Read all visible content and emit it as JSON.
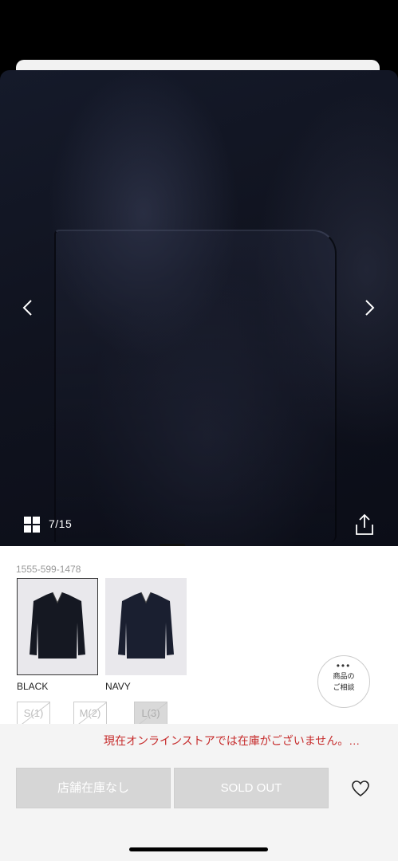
{
  "gallery": {
    "counter": "7/15",
    "prev_icon": "chevron-left-icon",
    "next_icon": "chevron-right-icon",
    "grid_icon": "grid-icon",
    "share_icon": "share-icon"
  },
  "product": {
    "code": "1555-599-1478",
    "colors": [
      {
        "label": "BLACK",
        "selected": true
      },
      {
        "label": "NAVY",
        "selected": false
      }
    ],
    "sizes": [
      {
        "label": "S(1)",
        "available": false
      },
      {
        "label": "M(2)",
        "available": false
      },
      {
        "label": "L(3)",
        "available": false
      }
    ],
    "consult": {
      "dots": "•••",
      "line1": "商品の",
      "line2": "ご相談"
    }
  },
  "stock": {
    "notice": "現在オンラインストアでは在庫がございません。…",
    "store_button": "店舗在庫なし",
    "soldout_button": "SOLD OUT",
    "favorite_icon": "heart-icon"
  },
  "colors": {
    "notice": "#c62b2b",
    "disabled_button": "#d6d6d6"
  }
}
